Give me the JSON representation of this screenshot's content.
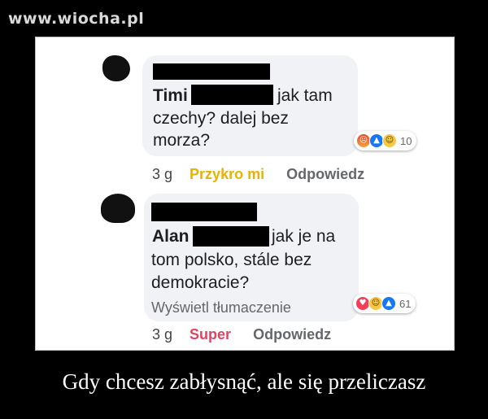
{
  "watermark": "www.wiocha.pl",
  "comments": [
    {
      "name": "Timi",
      "text_after_redaction": "jak tam",
      "text_lines": [
        "czechy? dalej bez",
        "morza?"
      ],
      "time": "3 g",
      "reaction_label": "Przykro mi",
      "reply_label": "Odpowiedz",
      "reactions": {
        "icons": [
          "angry-icon",
          "like-icon",
          "haha-icon"
        ],
        "count": "10"
      }
    },
    {
      "name": "Alan",
      "text_after_redaction": "jak je na",
      "text_lines": [
        "tom polsko, stále bez",
        "demokracie?"
      ],
      "translate_label": "Wyświetl tłumaczenie",
      "time": "3 g",
      "reaction_label": "Super",
      "reply_label": "Odpowiedz",
      "reactions": {
        "icons": [
          "love-icon",
          "haha-icon",
          "like-icon"
        ],
        "count": "61"
      }
    }
  ],
  "caption": "Gdy chcesz zabłysnąć, ale się przeliczasz",
  "colors": {
    "background": "#000000",
    "bubble": "#f0f2f5",
    "sad_reaction": "#e6b300",
    "love_reaction": "#e04460"
  }
}
